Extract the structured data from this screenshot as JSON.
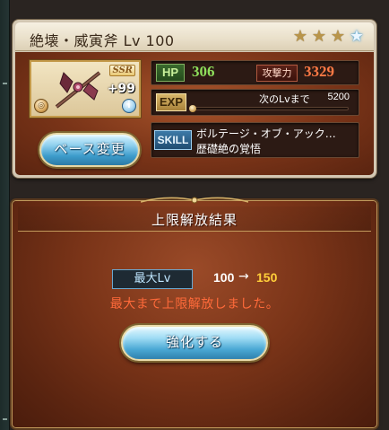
{
  "weapon": {
    "title": "絶壊・威寅斧 Lv 100",
    "rarity": "SSR",
    "plus": "+99",
    "stars": [
      "gold-star",
      "gold-star",
      "gold-star",
      "blue-star"
    ],
    "change_label": "ベース変更"
  },
  "stats": {
    "hp_label": "HP",
    "hp_value": "306",
    "atk_label": "攻撃力",
    "atk_value": "3329",
    "exp_label": "EXP",
    "exp_next_label": "次のLvまで",
    "exp_next_value": "5200",
    "exp_progress": 0.0
  },
  "skill": {
    "label": "SKILL",
    "name": "ボルテージ・オブ・アック…",
    "subtitle": "歴礎絶の覚悟"
  },
  "result": {
    "title": "上限解放結果",
    "lv_label": "最大Lv",
    "lv_from": "100",
    "arrow": "→",
    "lv_to": "150",
    "message": "最大まで上限解放しました。",
    "enhance_label": "強化する"
  },
  "colors": {
    "hp": "#8fe05c",
    "atk": "#ff7a45",
    "lv_to": "#ffcf3a",
    "message": "#ff6a3a",
    "button": "#4aa8d4"
  }
}
